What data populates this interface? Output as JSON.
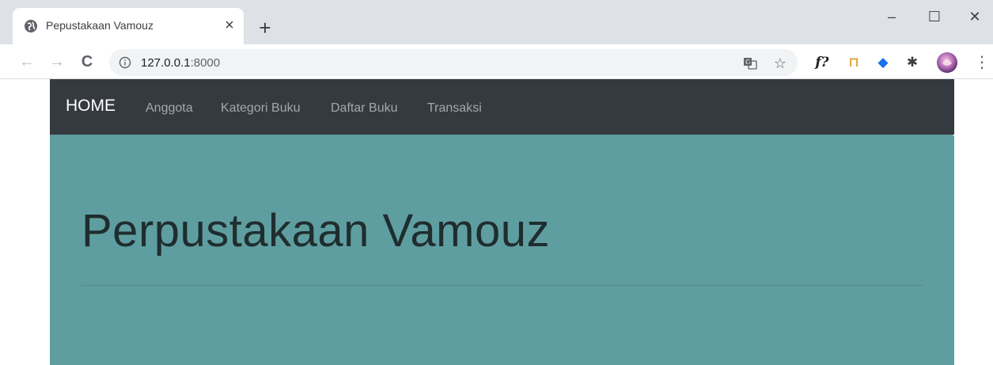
{
  "browser": {
    "tab": {
      "title": "Pepustakaan Vamouz",
      "favicon": "globe-icon",
      "close_glyph": "×"
    },
    "new_tab_glyph": "+",
    "window_controls": {
      "minimize": "–",
      "maximize": "☐",
      "close": "✕"
    },
    "toolbar": {
      "back": "←",
      "forward": "→",
      "reload": "C",
      "url_host": "127.0.0.1",
      "url_port": ":8000",
      "translate_icon": "translate-icon",
      "bookmark_glyph": "☆",
      "extensions": [
        {
          "name": "fx-extension",
          "text": "f?"
        },
        {
          "name": "ruler-extension",
          "text": "⊓"
        },
        {
          "name": "graduation-cap-extension",
          "text": "◆"
        },
        {
          "name": "puzzle-extension",
          "text": "✱"
        }
      ],
      "menu_glyph": "⋮"
    }
  },
  "site": {
    "navbar": {
      "brand": "HOME",
      "links": [
        "Anggota",
        "Kategori Buku",
        "Daftar Buku",
        "Transaksi"
      ]
    },
    "jumbotron": {
      "title": "Perpustakaan Vamouz"
    }
  },
  "colors": {
    "navbar_bg": "#343a40",
    "jumbotron_bg": "#5f9ea0",
    "tabstrip_bg": "#dee1e6"
  }
}
